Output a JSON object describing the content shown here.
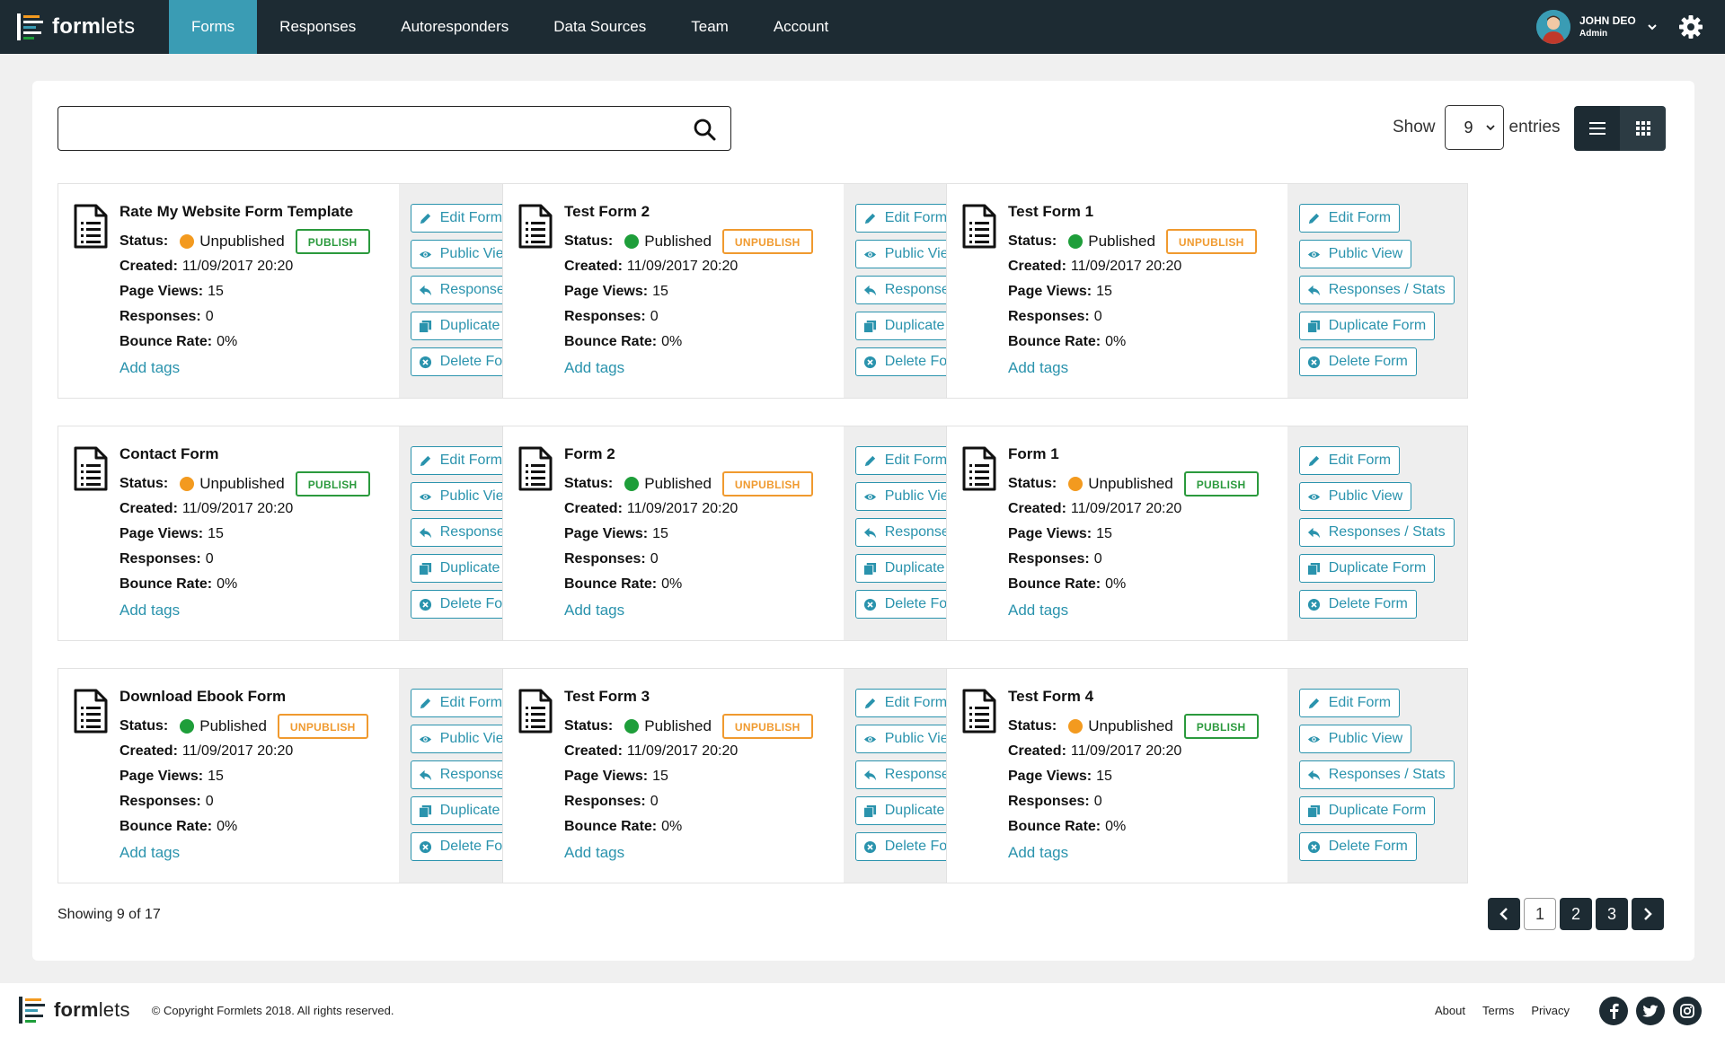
{
  "app": {
    "logo_text_bold": "form",
    "logo_text_rest": "lets"
  },
  "nav": [
    {
      "label": "Forms",
      "active": true
    },
    {
      "label": "Responses"
    },
    {
      "label": "Autoresponders"
    },
    {
      "label": "Data Sources"
    },
    {
      "label": "Team"
    },
    {
      "label": "Account"
    }
  ],
  "user": {
    "name": "JOHN DEO",
    "role": "Admin"
  },
  "toolbar": {
    "search_value": "",
    "show_label": "Show",
    "entries_value": "9",
    "entries_label": "entries"
  },
  "labels": {
    "status": "Status:",
    "created": "Created:",
    "page_views": "Page Views:",
    "responses": "Responses:",
    "bounce_rate": "Bounce Rate:",
    "add_tags": "Add tags",
    "edit": "Edit Form",
    "public_view": "Public View",
    "responses_stats": "Responses / Stats",
    "duplicate": "Duplicate Form",
    "delete": "Delete Form"
  },
  "forms": [
    {
      "title": "Rate My Website Form Template",
      "status": "Unpublished",
      "action": "PUBLISH",
      "created": "11/09/2017 20:20",
      "page_views": "15",
      "responses": "0",
      "bounce_rate": "0%"
    },
    {
      "title": "Test Form 2",
      "status": "Published",
      "action": "UNPUBLISH",
      "created": "11/09/2017 20:20",
      "page_views": "15",
      "responses": "0",
      "bounce_rate": "0%"
    },
    {
      "title": "Test Form 1",
      "status": "Published",
      "action": "UNPUBLISH",
      "created": "11/09/2017 20:20",
      "page_views": "15",
      "responses": "0",
      "bounce_rate": "0%"
    },
    {
      "title": "Contact Form",
      "status": "Unpublished",
      "action": "PUBLISH",
      "created": "11/09/2017 20:20",
      "page_views": "15",
      "responses": "0",
      "bounce_rate": "0%"
    },
    {
      "title": "Form 2",
      "status": "Published",
      "action": "UNPUBLISH",
      "created": "11/09/2017 20:20",
      "page_views": "15",
      "responses": "0",
      "bounce_rate": "0%"
    },
    {
      "title": "Form 1",
      "status": "Unpublished",
      "action": "PUBLISH",
      "created": "11/09/2017 20:20",
      "page_views": "15",
      "responses": "0",
      "bounce_rate": "0%"
    },
    {
      "title": "Download Ebook Form",
      "status": "Published",
      "action": "UNPUBLISH",
      "created": "11/09/2017 20:20",
      "page_views": "15",
      "responses": "0",
      "bounce_rate": "0%"
    },
    {
      "title": "Test Form 3",
      "status": "Published",
      "action": "UNPUBLISH",
      "created": "11/09/2017 20:20",
      "page_views": "15",
      "responses": "0",
      "bounce_rate": "0%"
    },
    {
      "title": "Test Form 4",
      "status": "Unpublished",
      "action": "PUBLISH",
      "created": "11/09/2017 20:20",
      "page_views": "15",
      "responses": "0",
      "bounce_rate": "0%"
    }
  ],
  "pagination": {
    "showing": "Showing 9 of 17",
    "pages": [
      "1",
      "2",
      "3"
    ],
    "current": "1"
  },
  "footer": {
    "copyright": "© Copyright Formlets 2018. All rights reserved.",
    "links": [
      "About",
      "Terms",
      "Privacy"
    ],
    "social": [
      "facebook-icon",
      "twitter-icon",
      "instagram-icon"
    ]
  },
  "colors": {
    "topbar": "#1d2b33",
    "accent": "#3a9cb4",
    "link": "#2a93ad",
    "published": "#1e9e3a",
    "unpublished": "#f39a1f"
  }
}
